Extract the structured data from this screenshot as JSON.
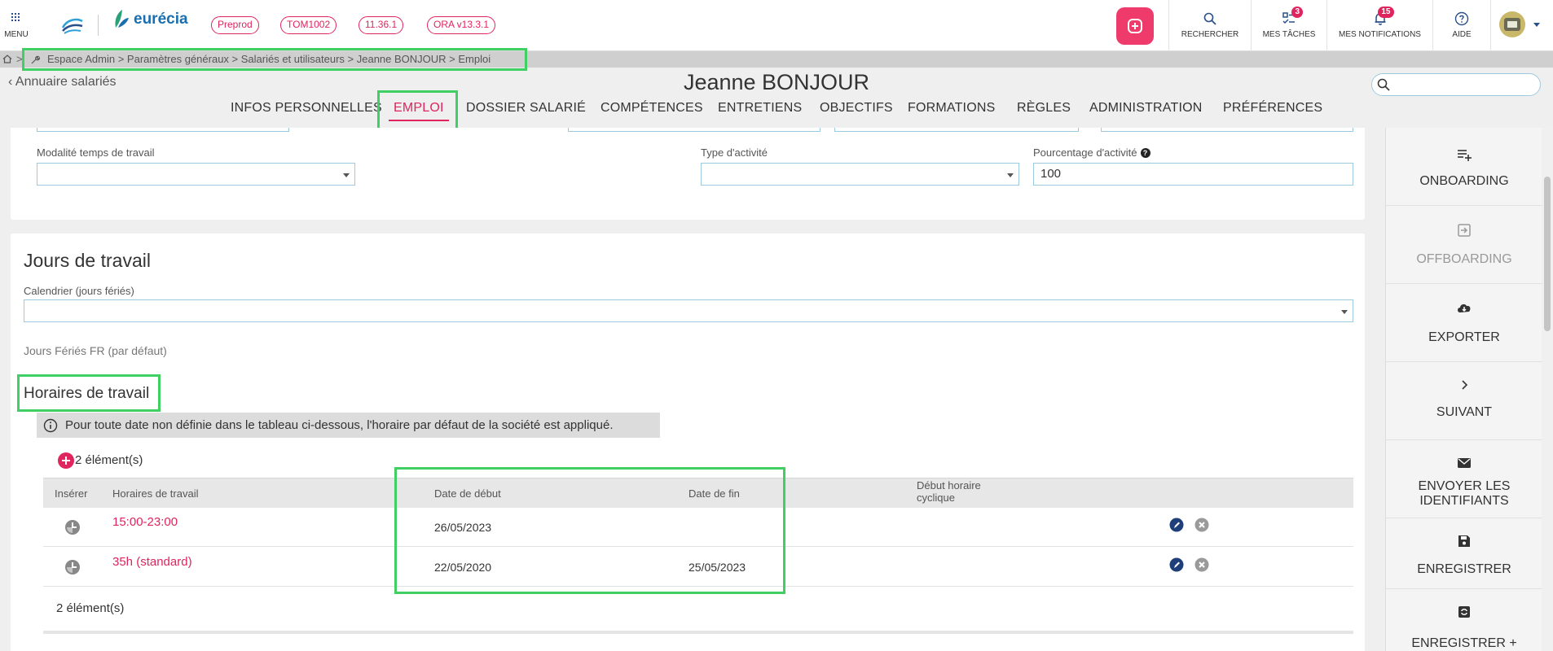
{
  "topbar": {
    "menu_label": "MENU",
    "brand": "eurécia",
    "badges": [
      "Preprod",
      "TOM1002",
      "11.36.1",
      "ORA v13.3.1"
    ],
    "tools": {
      "search_label": "RECHERCHER",
      "tasks_label": "MES TÂCHES",
      "tasks_count": "3",
      "notifications_label": "MES NOTIFICATIONS",
      "notifications_count": "15",
      "help_label": "AIDE"
    },
    "accent_color": "#ee3b6b"
  },
  "breadcrumb": {
    "separator": ">",
    "path": "Espace Admin > Paramètres généraux > Salariés et utilisateurs > Jeanne BONJOUR > Emploi"
  },
  "header": {
    "back_label": "Annuaire salariés",
    "employee_name": "Jeanne BONJOUR",
    "search_value": ""
  },
  "tabs": [
    {
      "label": "INFOS PERSONNELLES"
    },
    {
      "label": "EMPLOI",
      "active": true
    },
    {
      "label": "DOSSIER SALARIÉ"
    },
    {
      "label": "COMPÉTENCES"
    },
    {
      "label": "ENTRETIENS"
    },
    {
      "label": "OBJECTIFS"
    },
    {
      "label": "FORMATIONS"
    },
    {
      "label": "RÈGLES"
    },
    {
      "label": "ADMINISTRATION"
    },
    {
      "label": "PRÉFÉRENCES"
    }
  ],
  "work_fields": {
    "modalite_label": "Modalité temps de travail",
    "modalite_value": "",
    "type_label": "Type d'activité",
    "type_value": "",
    "pourcentage_label": "Pourcentage d'activité",
    "pourcentage_value": "100"
  },
  "jours": {
    "title": "Jours de travail",
    "calendar_label": "Calendrier (jours fériés)",
    "calendar_value": "",
    "default_note": "Jours Fériés FR (par défaut)"
  },
  "horaires": {
    "title": "Horaires de travail",
    "info": "Pour toute date non définie dans le tableau ci-dessous, l'horaire par défaut de la société est appliqué.",
    "count_label": "2 élément(s)",
    "columns": {
      "inserer": "Insérer",
      "horaires": "Horaires de travail",
      "debut": "Date de début",
      "fin": "Date de fin",
      "cyclique": "Début horaire cyclique"
    },
    "rows": [
      {
        "horaire": "15:00-23:00",
        "debut": "26/05/2023",
        "fin": "",
        "cyclique": ""
      },
      {
        "horaire": "35h (standard)",
        "debut": "22/05/2020",
        "fin": "25/05/2023",
        "cyclique": ""
      }
    ]
  },
  "side_actions": [
    {
      "label": "ONBOARDING",
      "icon": "list-add-icon",
      "disabled": false
    },
    {
      "label": "OFFBOARDING",
      "icon": "exit-icon",
      "disabled": true
    },
    {
      "label": "EXPORTER",
      "icon": "cloud-download-icon",
      "disabled": false
    },
    {
      "label": "SUIVANT",
      "icon": "chevron-right-icon",
      "disabled": false
    },
    {
      "label": "ENVOYER LES IDENTIFIANTS",
      "icon": "envelope-icon",
      "disabled": false
    },
    {
      "label": "ENREGISTRER",
      "icon": "save-icon",
      "disabled": false
    },
    {
      "label": "ENREGISTRER +",
      "icon": "save-refresh-icon",
      "disabled": false
    }
  ]
}
